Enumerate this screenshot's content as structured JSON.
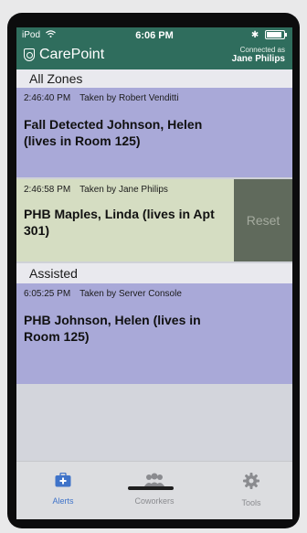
{
  "status_bar": {
    "carrier": "iPod",
    "time": "6:06 PM",
    "bluetooth": "✱"
  },
  "app": {
    "name": "CarePoint",
    "connected_label": "Connected as",
    "connected_user": "Jane Philips"
  },
  "sections": [
    {
      "title": "All Zones",
      "alerts": [
        {
          "time": "2:46:40 PM",
          "taken_by": "Taken by Robert Venditti",
          "title": "Fall Detected Johnson, Helen  (lives in Room 125)"
        },
        {
          "time": "2:46:58 PM",
          "taken_by": "Taken by Jane Philips",
          "title": "PHB Maples, Linda  (lives in Apt 301)",
          "action": "Reset"
        }
      ]
    },
    {
      "title": "Assisted",
      "alerts": [
        {
          "time": "6:05:25 PM",
          "taken_by": "Taken by Server Console",
          "title": "PHB Johnson, Helen  (lives in Room 125)"
        }
      ]
    }
  ],
  "tabbar": {
    "tabs": [
      "Alerts",
      "Coworkers",
      "Tools"
    ],
    "active": "Alerts"
  },
  "colors": {
    "header": "#2f6d5d",
    "alert_row": "#a9a9d8",
    "swiped_row": "#d5ddc2",
    "reset": "#606a5c",
    "active_tab": "#3f73c9"
  },
  "icons": {
    "logo": "carepoint-logo-icon",
    "alerts": "medical-kit-icon",
    "coworkers": "people-icon",
    "tools": "gear-icon"
  }
}
